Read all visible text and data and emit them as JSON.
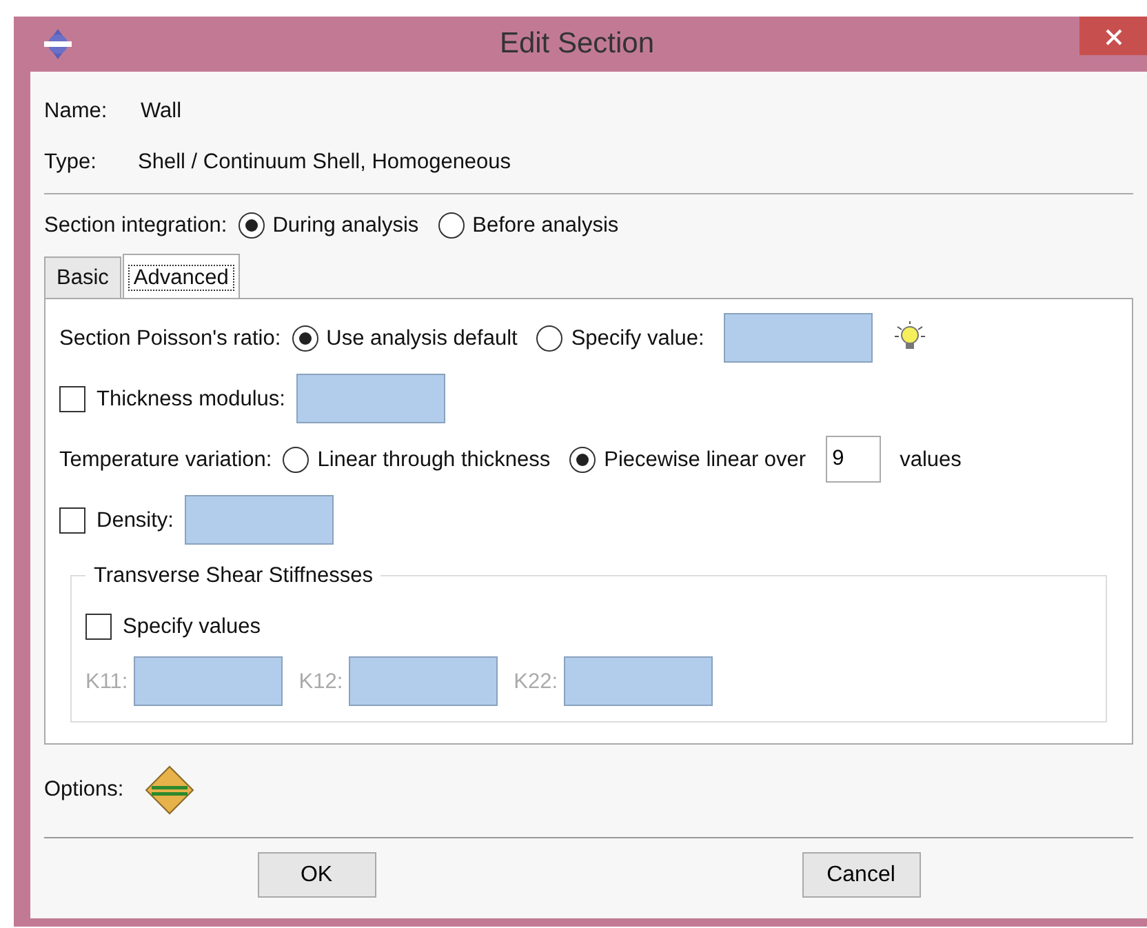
{
  "window": {
    "title": "Edit Section"
  },
  "name": {
    "label": "Name:",
    "value": "Wall"
  },
  "type": {
    "label": "Type:",
    "value": "Shell / Continuum Shell, Homogeneous"
  },
  "integration": {
    "label": "Section integration:",
    "options": [
      {
        "label": "During analysis",
        "selected": true
      },
      {
        "label": "Before analysis",
        "selected": false
      }
    ]
  },
  "tabs": [
    {
      "label": "Basic",
      "selected": false
    },
    {
      "label": "Advanced",
      "selected": true
    }
  ],
  "poisson": {
    "label": "Section Poisson's ratio:",
    "options": [
      {
        "label": "Use analysis default",
        "selected": true
      },
      {
        "label": "Specify value:",
        "selected": false
      }
    ]
  },
  "thickness_modulus": {
    "label": "Thickness modulus:",
    "checked": false
  },
  "temperature": {
    "label": "Temperature variation:",
    "options": [
      {
        "label": "Linear through thickness",
        "selected": false
      },
      {
        "label": "Piecewise linear over",
        "selected": true
      }
    ],
    "count": "9",
    "suffix": "values"
  },
  "density": {
    "label": "Density:",
    "checked": false
  },
  "shear": {
    "title": "Transverse Shear Stiffnesses",
    "specify": {
      "label": "Specify values",
      "checked": false
    },
    "fields": [
      {
        "label": "K11:",
        "disabled": true
      },
      {
        "label": "K12:",
        "disabled": true
      },
      {
        "label": "K22:",
        "disabled": true
      }
    ]
  },
  "options": {
    "label": "Options:"
  },
  "buttons": [
    "OK",
    "Cancel"
  ]
}
